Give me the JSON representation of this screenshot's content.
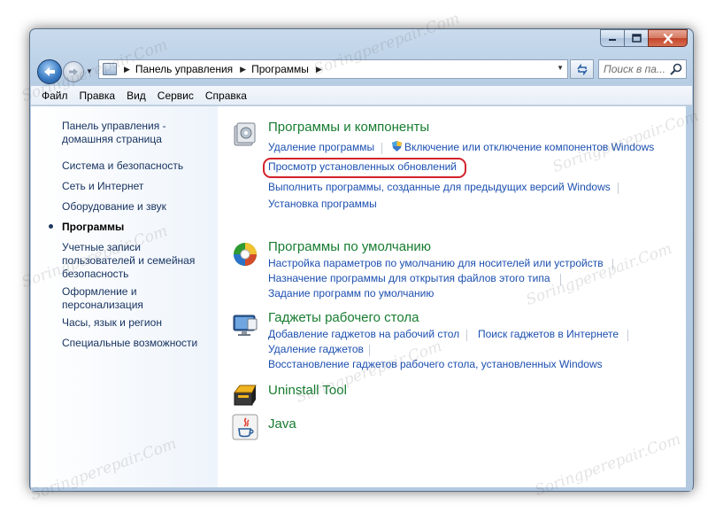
{
  "address": {
    "crumbs": [
      "Панель управления",
      "Программы"
    ],
    "search_placeholder": "Поиск в па..."
  },
  "menu": [
    "Файл",
    "Правка",
    "Вид",
    "Сервис",
    "Справка"
  ],
  "sidebar": {
    "items": [
      {
        "label": "Панель управления - домашняя страница",
        "lines": [
          "Панель управления -",
          "домашняя страница"
        ]
      },
      {
        "label": "Система и безопасность"
      },
      {
        "label": "Сеть и Интернет"
      },
      {
        "label": "Оборудование и звук"
      },
      {
        "label": "Программы",
        "current": true
      },
      {
        "label": "Учетные записи пользователей и семейная безопасность",
        "lines": [
          "Учетные записи",
          "пользователей и семейная",
          "безопасность"
        ]
      },
      {
        "label": "Оформление и персонализация",
        "lines": [
          "Оформление и",
          "персонализация"
        ]
      },
      {
        "label": "Часы, язык и регион"
      },
      {
        "label": "Специальные возможности"
      }
    ]
  },
  "categories": [
    {
      "title": "Программы и компоненты",
      "links": [
        "Удаление программы",
        "Включение или отключение компонентов Windows",
        "Просмотр установленных обновлений",
        "Выполнить программы, созданные для предыдущих версий Windows",
        "Установка программы"
      ]
    },
    {
      "title": "Программы по умолчанию",
      "links": [
        "Настройка параметров по умолчанию для носителей или устройств",
        "Назначение программы для открытия файлов этого типа",
        "Задание программ по умолчанию"
      ]
    },
    {
      "title": "Гаджеты рабочего стола",
      "links": [
        "Добавление гаджетов на рабочий стол",
        "Поиск гаджетов в Интернете",
        "Удаление гаджетов",
        "Восстановление гаджетов рабочего стола, установленных Windows"
      ]
    },
    {
      "title": "Uninstall Tool",
      "links": []
    },
    {
      "title": "Java",
      "links": []
    }
  ],
  "watermark": "Soringperepair.Com",
  "colors": {
    "category_title": "#177c30",
    "link": "#1c4fb0",
    "highlight_ring": "#d3222a"
  }
}
